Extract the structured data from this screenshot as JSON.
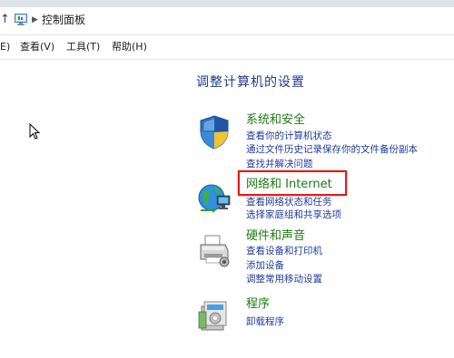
{
  "window": {
    "breadcrumb": "控制面板",
    "up_symbol": "↑",
    "chevron_symbol": "▶"
  },
  "menu": {
    "items": [
      "E)",
      "查看(V)",
      "工具(T)",
      "帮助(H)"
    ]
  },
  "main": {
    "heading": "调整计算机的设置",
    "categories": [
      {
        "icon": "shield-icon",
        "title": "系统和安全",
        "links": [
          "查看你的计算机状态",
          "通过文件历史记录保存你的文件备份副本",
          "查找并解决问题"
        ]
      },
      {
        "icon": "network-globe-icon",
        "title": "网络和 Internet",
        "links": [
          "查看网络状态和任务",
          "选择家庭组和共享选项"
        ]
      },
      {
        "icon": "printer-icon",
        "title": "硬件和声音",
        "links": [
          "查看设备和打印机",
          "添加设备",
          "调整常用移动设置"
        ]
      },
      {
        "icon": "programs-icon",
        "title": "程序",
        "links": [
          "卸载程序"
        ]
      }
    ]
  },
  "colors": {
    "category_title": "#1f7a16",
    "link": "#1f3c9c",
    "heading": "#1e3a8c",
    "highlight": "#e01b1b"
  }
}
